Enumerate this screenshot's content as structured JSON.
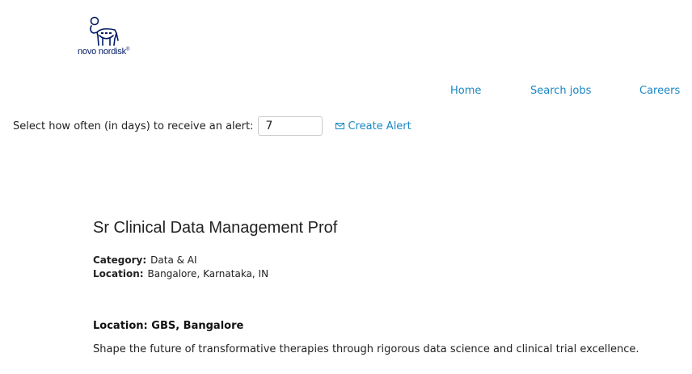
{
  "brand": {
    "logo_text": "novo nordisk",
    "logo_mark": "®",
    "color": "#001965"
  },
  "nav": {
    "home": "Home",
    "search_jobs": "Search jobs",
    "careers": "Careers",
    "link_color": "#1a87c4"
  },
  "alert": {
    "label": "Select how often (in days) to receive an alert:",
    "value": "7",
    "create_label": "Create Alert",
    "icon": "envelope-icon"
  },
  "job": {
    "title": "Sr Clinical Data Management Prof",
    "category_label": "Category:",
    "category_value": "Data & AI",
    "location_label": "Location:",
    "location_value": "Bangalore, Karnataka, IN",
    "sub_location": "Location: GBS, Bangalore",
    "description": "Shape the future of transformative therapies through rigorous data science and clinical trial excellence."
  }
}
